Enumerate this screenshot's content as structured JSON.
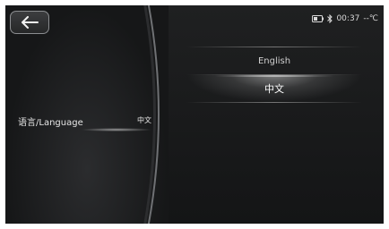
{
  "header": {
    "back_icon": "arrow-left-icon",
    "status": {
      "battery_icon": "battery-icon",
      "bluetooth_icon": "bluetooth-icon",
      "time": "00:37",
      "temperature": "--℃"
    }
  },
  "settings": {
    "language": {
      "label": "语言/Language",
      "value": "中文"
    }
  },
  "language_options": [
    {
      "label": "English",
      "selected": false
    },
    {
      "label": "中文",
      "selected": true
    }
  ],
  "colors": {
    "background": "#151617",
    "text": "#e6e6e6",
    "border": "#8b8d90"
  }
}
